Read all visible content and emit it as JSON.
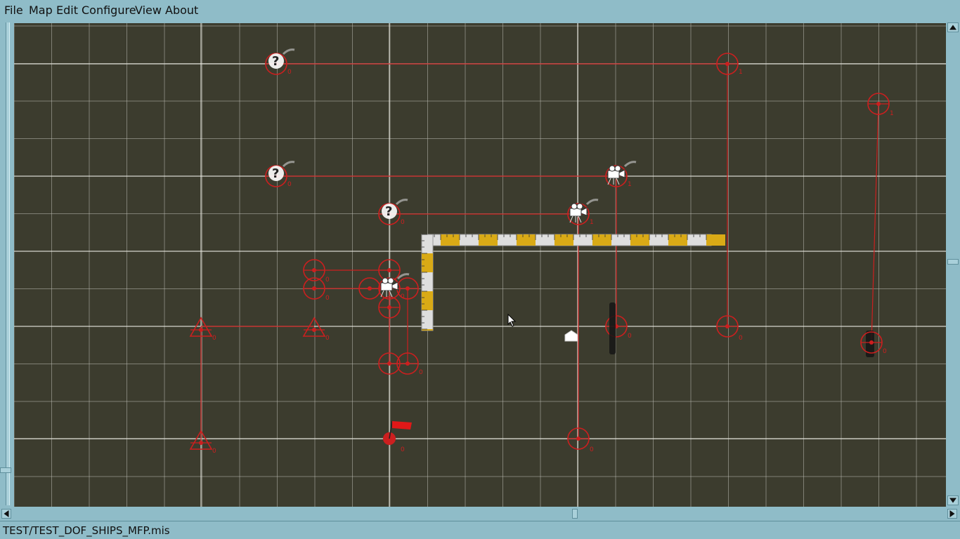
{
  "menu": [
    {
      "label": "File"
    },
    {
      "label": "Map"
    },
    {
      "label": "Edit"
    },
    {
      "label": "Configure"
    },
    {
      "label": "View"
    },
    {
      "label": "About"
    }
  ],
  "status": {
    "file": "TEST/TEST_DOF_SHIPS_MFP.mis"
  },
  "colors": {
    "map_bg": "#3c3c2e",
    "grid": "#b9b9b0",
    "route": "#cc1f1f",
    "chrome": "#8fbcc8",
    "ruler_yellow": "#d9aa16",
    "ruler_white": "#dedede"
  },
  "map_objects": [
    {
      "type": "question-waypoint",
      "icon": "question-mark-icon",
      "index": "0"
    },
    {
      "type": "waypoint",
      "icon": "waypoint-circle-icon",
      "index": "1"
    },
    {
      "type": "waypoint",
      "icon": "waypoint-circle-icon",
      "index": "0"
    },
    {
      "type": "question-waypoint",
      "icon": "question-mark-icon",
      "index": "0"
    },
    {
      "type": "camera-waypoint",
      "icon": "movie-camera-icon",
      "index": "1"
    },
    {
      "type": "question-waypoint",
      "icon": "question-mark-icon",
      "index": "0"
    },
    {
      "type": "camera-waypoint",
      "icon": "movie-camera-icon",
      "index": "1"
    },
    {
      "type": "home-marker",
      "icon": "house-icon"
    },
    {
      "type": "flag-marker",
      "icon": "flag-icon",
      "index": "0"
    },
    {
      "type": "triangle-waypoint",
      "icon": "triangle-icon",
      "index": "0"
    },
    {
      "type": "triangle-waypoint",
      "icon": "triangle-icon",
      "index": "0"
    },
    {
      "type": "triangle-waypoint",
      "icon": "triangle-icon",
      "index": "0"
    },
    {
      "type": "ship-waypoint",
      "icon": "ship-icon",
      "index": "0"
    },
    {
      "type": "ship-waypoint",
      "icon": "ship-icon",
      "index": "0"
    }
  ],
  "ruler": {
    "label": "scale ruler"
  }
}
